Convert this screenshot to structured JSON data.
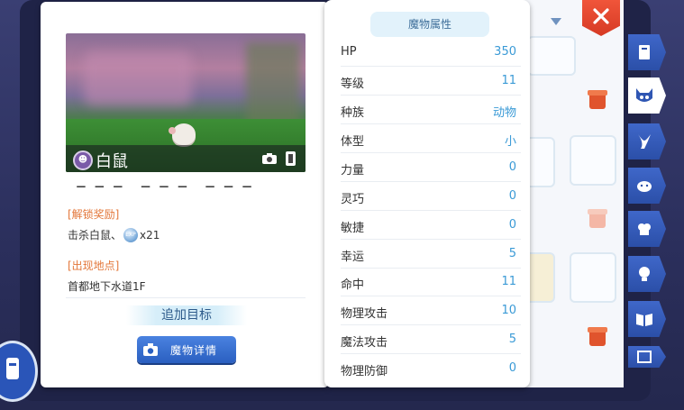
{
  "monster": {
    "name": "白鼠",
    "race_icon": "demon-race-icon"
  },
  "left_panel": {
    "truncated_text": "(文本被遮挡)",
    "unlock_title": "[解锁奖励]",
    "reward_text": "击杀白鼠、",
    "reward_icon": "exp-icon",
    "reward_icon_text": "EXP",
    "reward_count": "x21",
    "location_title": "[出现地点]",
    "location": "首都地下水道1F",
    "add_target_label": "追加目标",
    "detail_button_label": "魔物详情"
  },
  "attributes": {
    "header": "魔物属性",
    "rows": [
      {
        "label": "HP",
        "value": "350"
      },
      {
        "label": "等级",
        "value": "11"
      },
      {
        "label": "种族",
        "value": "动物"
      },
      {
        "label": "体型",
        "value": "小"
      },
      {
        "label": "力量",
        "value": "0"
      },
      {
        "label": "灵巧",
        "value": "0"
      },
      {
        "label": "敏捷",
        "value": "0"
      },
      {
        "label": "幸运",
        "value": "5"
      },
      {
        "label": "命中",
        "value": "11"
      },
      {
        "label": "物理攻击",
        "value": "10"
      },
      {
        "label": "魔法攻击",
        "value": "5"
      },
      {
        "label": "物理防御",
        "value": "0"
      }
    ]
  },
  "side_tabs": [
    {
      "icon": "card-book-icon",
      "active": false
    },
    {
      "icon": "monster-face-icon",
      "active": true
    },
    {
      "icon": "horn-icon",
      "active": false
    },
    {
      "icon": "pet-icon",
      "active": false
    },
    {
      "icon": "chef-hat-icon",
      "active": false
    },
    {
      "icon": "trophy-head-icon",
      "active": false
    },
    {
      "icon": "open-book-icon",
      "active": false
    },
    {
      "icon": "frame-icon",
      "active": false
    }
  ],
  "colors": {
    "accent_blue": "#3a9ad6",
    "section_orange": "#e3773a",
    "close_red": "#e0462f",
    "tab_blue": "#2f56b3"
  }
}
